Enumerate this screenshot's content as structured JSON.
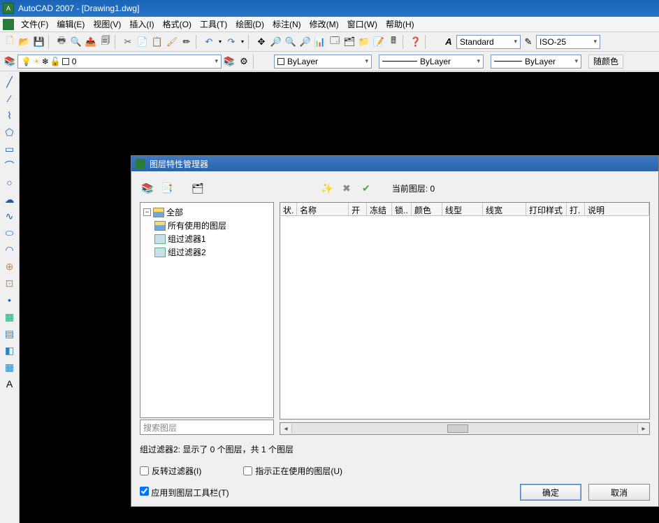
{
  "title": "AutoCAD 2007 - [Drawing1.dwg]",
  "menus": [
    "文件(F)",
    "编辑(E)",
    "视图(V)",
    "插入(I)",
    "格式(O)",
    "工具(T)",
    "绘图(D)",
    "标注(N)",
    "修改(M)",
    "窗口(W)",
    "帮助(H)"
  ],
  "style_combo": "Standard",
  "dim_combo": "ISO-25",
  "layer_combo_value": "0",
  "bylayer": "ByLayer",
  "color_btn": "随颜色",
  "dialog": {
    "title": "图层特性管理器",
    "current_label": "当前图层: 0",
    "tree": {
      "root": "全部",
      "children": [
        "所有使用的图层",
        "组过滤器1",
        "组过滤器2"
      ]
    },
    "search_placeholder": "搜索图层",
    "columns": [
      "状.",
      "名称",
      "开",
      "冻结",
      "锁..",
      "颜色",
      "线型",
      "线宽",
      "打印样式",
      "打.",
      "说明"
    ],
    "status_text": "组过滤器2: 显示了 0 个图层，共 1 个图层",
    "chk_invert": "反转过滤器(I)",
    "chk_indicate": "指示正在使用的图层(U)",
    "chk_apply": "应用到图层工具栏(T)",
    "btn_ok": "确定",
    "btn_cancel": "取消"
  }
}
